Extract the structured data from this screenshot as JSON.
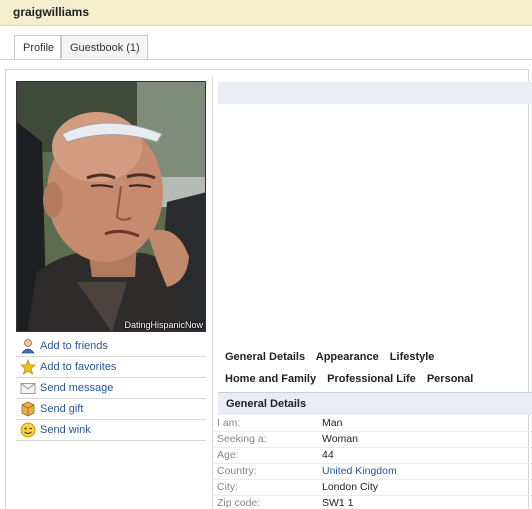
{
  "header": {
    "username": "graigwilliams"
  },
  "tabs": [
    {
      "label": "Profile"
    },
    {
      "label": "Guestbook (1)"
    }
  ],
  "photo": {
    "watermark": "DatingHispanicNow"
  },
  "actions": [
    {
      "label": "Add to friends",
      "icon": "person-add-icon"
    },
    {
      "label": "Add to favorites",
      "icon": "star-icon"
    },
    {
      "label": "Send message",
      "icon": "envelope-icon"
    },
    {
      "label": "Send gift",
      "icon": "gift-icon"
    },
    {
      "label": "Send wink",
      "icon": "wink-smiley-icon"
    }
  ],
  "section_nav": {
    "row1": [
      "General Details",
      "Appearance",
      "Lifestyle"
    ],
    "row2": [
      "Home and Family",
      "Professional Life",
      "Personal"
    ]
  },
  "details": {
    "title": "General Details",
    "rows": [
      {
        "key": "I am:",
        "value": "Man"
      },
      {
        "key": "Seeking a:",
        "value": "Woman"
      },
      {
        "key": "Age:",
        "value": "44"
      },
      {
        "key": "Country:",
        "value": "United Kingdom"
      },
      {
        "key": "City:",
        "value": "London City"
      },
      {
        "key": "Zip code:",
        "value": "SW1 1"
      }
    ]
  },
  "colors": {
    "title_bar": "#f3efce",
    "link": "#2a5698",
    "section_header": "#e9edf3"
  }
}
